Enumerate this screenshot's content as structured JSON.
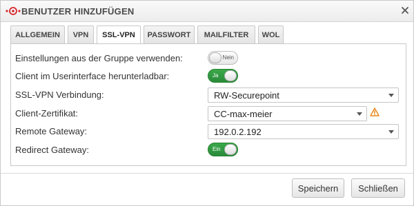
{
  "dialog": {
    "title": "BENUTZER HINZUFÜGEN",
    "logo_icon": "securepoint-logo-icon",
    "close_icon": "close-icon"
  },
  "tabs": [
    {
      "label": "ALLGEMEIN",
      "active": false
    },
    {
      "label": "VPN",
      "active": false
    },
    {
      "label": "SSL-VPN",
      "active": true
    },
    {
      "label": "PASSWORT",
      "active": false
    },
    {
      "label": "MAILFILTER",
      "active": false
    },
    {
      "label": "WOL",
      "active": false
    }
  ],
  "form": {
    "group_settings": {
      "label": "Einstellungen aus der Gruppe verwenden:",
      "toggle_text": "Nein",
      "state": "off"
    },
    "client_download": {
      "label": "Client im Userinterface herunterladbar:",
      "toggle_text": "Ja",
      "state": "on"
    },
    "ssl_vpn_connection": {
      "label": "SSL-VPN Verbindung:",
      "value": "RW-Securepoint"
    },
    "client_certificate": {
      "label": "Client-Zertifikat:",
      "value": "CC-max-meier",
      "warning_icon": "warning-icon"
    },
    "remote_gateway": {
      "label": "Remote Gateway:",
      "value": "192.0.2.192"
    },
    "redirect_gateway": {
      "label": "Redirect Gateway:",
      "toggle_text": "Ein",
      "state": "on"
    }
  },
  "buttons": {
    "save": "Speichern",
    "close": "Schließen"
  },
  "colors": {
    "toggle_on": "#2e9a40",
    "warning": "#e8891c",
    "logo_red": "#d6262a"
  }
}
